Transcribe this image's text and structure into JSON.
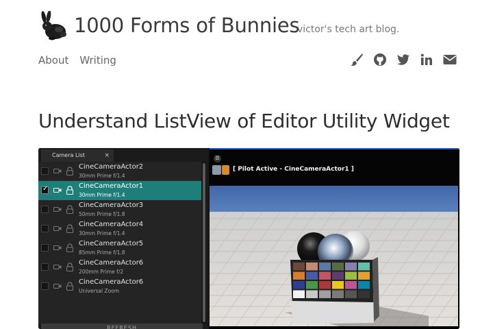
{
  "site": {
    "title": "1000 Forms of Bunnies",
    "tagline": "victor's tech art blog."
  },
  "nav": [
    {
      "label": "About"
    },
    {
      "label": "Writing"
    }
  ],
  "social_icons": [
    "brush-icon",
    "github-icon",
    "twitter-icon",
    "linkedin-icon",
    "email-icon"
  ],
  "post": {
    "title": "Understand ListView of Editor Utility Widget"
  },
  "editor": {
    "panel_tab": "Camera List",
    "close_glyph": "×",
    "cameras": [
      {
        "name": "CineCameraActor2",
        "desc": "30mm Prime f/1.4",
        "checked": false,
        "selected": false
      },
      {
        "name": "CineCameraActor1",
        "desc": "30mm Prime f/1.4",
        "checked": true,
        "selected": true
      },
      {
        "name": "CineCameraActor3",
        "desc": "50mm Prime f/1.8",
        "checked": false,
        "selected": false
      },
      {
        "name": "CineCameraActor4",
        "desc": "30mm Prime f/1.4",
        "checked": false,
        "selected": false
      },
      {
        "name": "CineCameraActor5",
        "desc": "85mm Prime f/1.8",
        "checked": false,
        "selected": false
      },
      {
        "name": "CineCameraActor6",
        "desc": "200mm Prime f/2",
        "checked": false,
        "selected": false
      },
      {
        "name": "CineCameraActor6",
        "desc": "Universal Zoom",
        "checked": false,
        "selected": false
      }
    ],
    "refresh_label": "REFRESH",
    "viewport": {
      "pilot_text": "[ Pilot Active - CineCameraActor1 ]"
    }
  },
  "colors": {
    "selection": "#1e7f7a",
    "accent_blue": "#1e62c9"
  }
}
